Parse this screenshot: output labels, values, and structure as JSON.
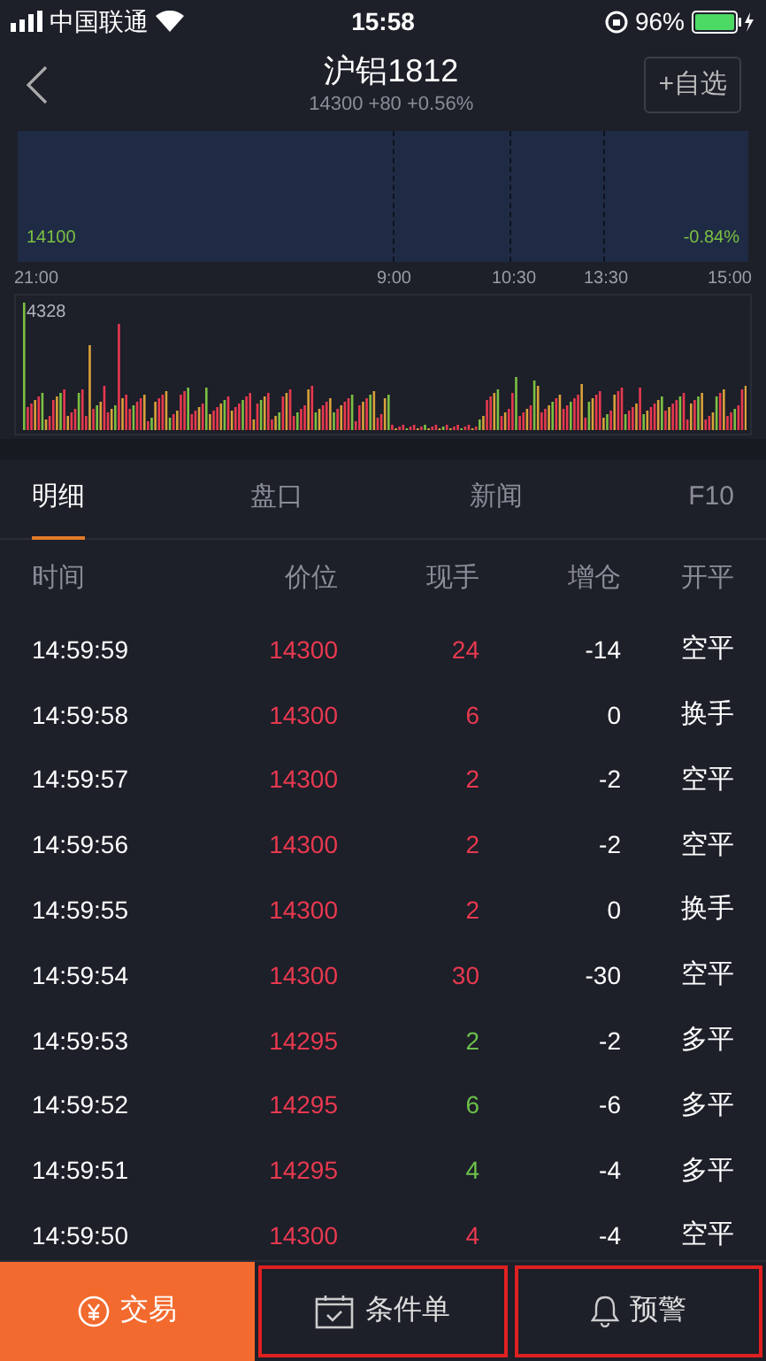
{
  "status_bar": {
    "carrier": "中国联通",
    "time": "15:58",
    "battery": "96%"
  },
  "header": {
    "title": "沪铝1812",
    "subtitle": "14300 +80 +0.56%",
    "watch_button": "+自选"
  },
  "price_chart": {
    "low_label": "14100",
    "low_pct": "-0.84%",
    "times": [
      "21:00",
      "9:00",
      "10:30",
      "13:30",
      "15:00"
    ]
  },
  "volume_chart": {
    "max_label": "4328"
  },
  "tabs": [
    {
      "label": "明细",
      "selected": true
    },
    {
      "label": "盘口",
      "selected": false
    },
    {
      "label": "新闻",
      "selected": false
    },
    {
      "label": "F10",
      "selected": false
    }
  ],
  "table": {
    "columns": [
      "时间",
      "价位",
      "现手",
      "增仓",
      "开平"
    ],
    "rows": [
      {
        "time": "14:59:59",
        "price": "14300",
        "qty": "24",
        "color": "#e8394f",
        "oi": "-14",
        "type": "空平"
      },
      {
        "time": "14:59:58",
        "price": "14300",
        "qty": "6",
        "color": "#e8394f",
        "oi": "0",
        "type": "换手"
      },
      {
        "time": "14:59:57",
        "price": "14300",
        "qty": "2",
        "color": "#e8394f",
        "oi": "-2",
        "type": "空平"
      },
      {
        "time": "14:59:56",
        "price": "14300",
        "qty": "2",
        "color": "#e8394f",
        "oi": "-2",
        "type": "空平"
      },
      {
        "time": "14:59:55",
        "price": "14300",
        "qty": "2",
        "color": "#e8394f",
        "oi": "0",
        "type": "换手"
      },
      {
        "time": "14:59:54",
        "price": "14300",
        "qty": "30",
        "color": "#e8394f",
        "oi": "-30",
        "type": "空平"
      },
      {
        "time": "14:59:53",
        "price": "14295",
        "qty": "2",
        "color": "#6cc04a",
        "oi": "-2",
        "type": "多平"
      },
      {
        "time": "14:59:52",
        "price": "14295",
        "qty": "6",
        "color": "#6cc04a",
        "oi": "-6",
        "type": "多平"
      },
      {
        "time": "14:59:51",
        "price": "14295",
        "qty": "4",
        "color": "#6cc04a",
        "oi": "-4",
        "type": "多平"
      },
      {
        "time": "14:59:50",
        "price": "14300",
        "qty": "4",
        "color": "#e8394f",
        "oi": "-4",
        "type": "空平"
      }
    ]
  },
  "bottom_bar": [
    {
      "kind": "trade",
      "label": "交易",
      "highlighted": false
    },
    {
      "kind": "condition",
      "label": "条件单",
      "highlighted": true
    },
    {
      "kind": "alert",
      "label": "预警",
      "highlighted": true
    }
  ]
}
